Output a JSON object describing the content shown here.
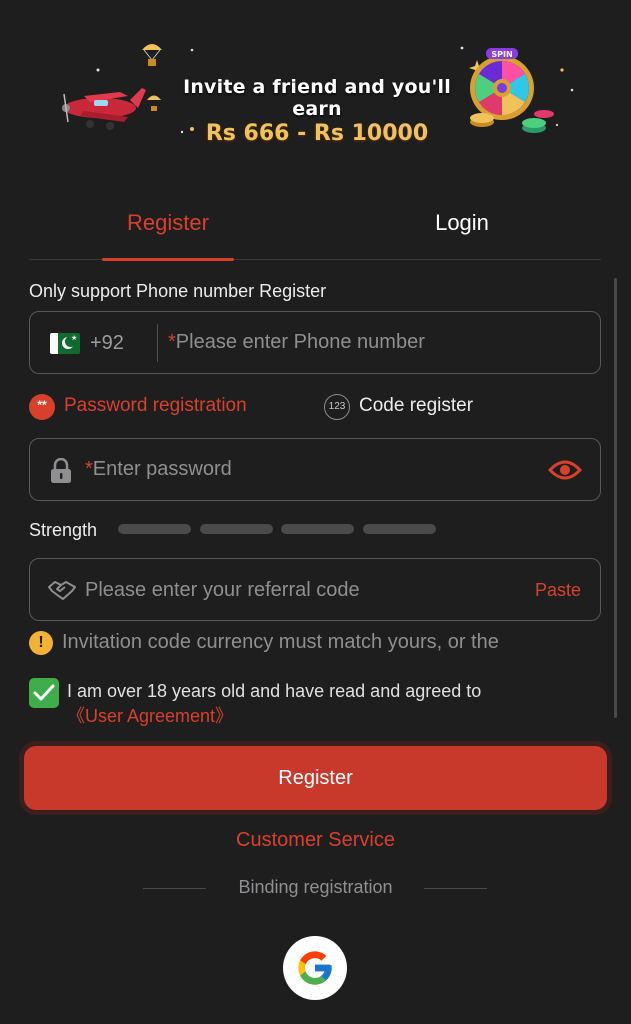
{
  "banner": {
    "line1": "Invite a friend and you'll earn",
    "line2": "Rs 666 - Rs 10000",
    "wheel_label": "SPIN"
  },
  "tabs": [
    {
      "label": "Register",
      "active": true
    },
    {
      "label": "Login",
      "active": false
    }
  ],
  "form": {
    "section_label": "Only support Phone number Register",
    "phone": {
      "country_code": "+92",
      "required_mark": "*",
      "placeholder": "Please enter Phone number"
    },
    "modes": {
      "password": {
        "icon_text": "**",
        "label": "Password registration",
        "selected": true
      },
      "code": {
        "icon_text": "123",
        "label": "Code register",
        "selected": false
      }
    },
    "password": {
      "required_mark": "*",
      "placeholder": "Enter password"
    },
    "strength": {
      "label": "Strength",
      "segments": 4,
      "filled": 0
    },
    "referral": {
      "placeholder": "Please enter your referral code",
      "paste_label": "Paste"
    },
    "warning": {
      "icon_text": "!",
      "text": "Invitation code currency must match yours, or the"
    },
    "agreement": {
      "checked": true,
      "text": "I am over 18 years old and have read and agreed to",
      "link": "《User Agreement》"
    },
    "register_button": "Register"
  },
  "customer_service": "Customer Service",
  "binding": {
    "label": "Binding registration"
  },
  "colors": {
    "accent": "#d9402c",
    "background": "#1e1e1f",
    "check": "#3fae4a",
    "warning": "#f2b233"
  }
}
